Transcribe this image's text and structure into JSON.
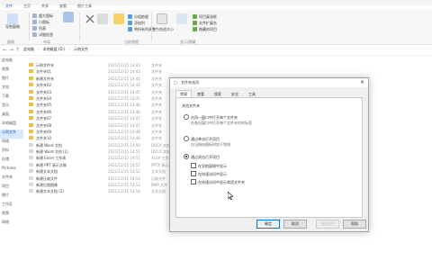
{
  "title_bar": {
    "text": "文件夹选项"
  },
  "tabs": [
    "文件",
    "主页",
    "共享",
    "查看",
    "图片工具"
  ],
  "ribbon": {
    "nav_pane_label": "导航窗格",
    "layout_options": [
      "超大图标",
      "小图标",
      "列表",
      "详细信息"
    ],
    "current_view_options": [
      "分组依据",
      "添加列",
      "将所有列调整为合适大小"
    ],
    "show_hide_options": [
      "项目复选框",
      "文件扩展名",
      "隐藏的项目"
    ],
    "options_label": "选项",
    "groups": [
      "窗格",
      "布局",
      "当前视图",
      "显示/隐藏"
    ]
  },
  "address": {
    "crumbs": [
      "此电脑",
      "本地磁盘 (D:)",
      "示例文件"
    ]
  },
  "nav_pane": {
    "items": [
      "此电脑",
      "视频",
      "图片",
      "文档",
      "下载",
      "音乐",
      "桌面",
      "本地磁盘",
      "示例文件",
      "网络",
      "资料",
      "存储",
      "Pictures",
      "文件夹",
      "项目",
      "图片",
      "工作区",
      "视频",
      "网络"
    ]
  },
  "files": [
    {
      "name": "示例文件夹",
      "date": "2021/12/15 14:43",
      "type": "文件夹"
    },
    {
      "name": "文件夹01",
      "date": "2021/12/15 14:43",
      "type": "文件夹"
    },
    {
      "name": "新建文件夹",
      "date": "2021/12/15 14:44",
      "type": "文件夹"
    },
    {
      "name": "文件夹02",
      "date": "2021/12/15 14:44",
      "type": "文件夹"
    },
    {
      "name": "文件夹03",
      "date": "2021/12/15 14:45",
      "type": "文件夹"
    },
    {
      "name": "文件夹04",
      "date": "2021/12/15 14:45",
      "type": "文件夹"
    },
    {
      "name": "文件夹05",
      "date": "2021/12/15 14:46",
      "type": "文件夹"
    },
    {
      "name": "文件夹06",
      "date": "2021/12/15 14:46",
      "type": "文件夹"
    },
    {
      "name": "文件夹07",
      "date": "2021/12/15 14:47",
      "type": "文件夹"
    },
    {
      "name": "文件夹08",
      "date": "2021/12/15 14:47",
      "type": "文件夹"
    },
    {
      "name": "文件夹09",
      "date": "2021/12/15 14:48",
      "type": "文件夹"
    },
    {
      "name": "文件夹10",
      "date": "2021/12/15 14:48",
      "type": "文件夹"
    },
    {
      "name": "新建 Word 文档",
      "date": "2021/12/15 14:50",
      "type": "DOCX 文档"
    },
    {
      "name": "新建 Word 文档 (2)",
      "date": "2021/12/15 14:51",
      "type": "DOCX 文档"
    },
    {
      "name": "新建 Excel 工作表",
      "date": "2021/12/15 14:51",
      "type": "XLSX 工作表"
    },
    {
      "name": "新建 PPT 演示文稿",
      "date": "2021/12/15 14:52",
      "type": "PPTX 演示文稿"
    },
    {
      "name": "新建文本文档",
      "date": "2021/12/15 14:52",
      "type": "文本文档"
    },
    {
      "name": "新建压缩文件",
      "date": "2021/12/15 14:53",
      "type": "压缩文件"
    },
    {
      "name": "新建位图图像",
      "date": "2021/12/15 14:53",
      "type": "BMP 文件"
    },
    {
      "name": "新建文本文档 (2)",
      "date": "2021/12/15 14:54",
      "type": "文本文档"
    }
  ],
  "dialog": {
    "title": "文件夹选项",
    "tabs": [
      "常规",
      "查看",
      "搜索",
      "安全",
      "工具"
    ],
    "section_label": "浏览文件夹",
    "options": [
      {
        "label": "在同一窗口中打开每个文件夹",
        "note": "在各自窗口中打开每个文件夹时的标签"
      },
      {
        "label": "通过单击打开项目",
        "note": "仅当指向图标时加下划线"
      },
      {
        "label": "通过双击打开项目",
        "note": ""
      }
    ],
    "sub_checks": [
      "在导航窗格中显示",
      "在快速访问中显示",
      "在快速访问中显示常用文件夹"
    ],
    "buttons": {
      "ok": "确定",
      "cancel": "取消",
      "apply": "应用(A)",
      "help": "帮助"
    }
  },
  "colors": {
    "accent": "#0078d7",
    "folder": "#e8bf4a",
    "selection": "#d9e8fb"
  }
}
